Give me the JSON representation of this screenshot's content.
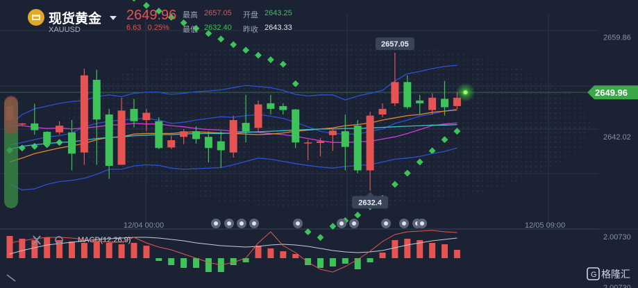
{
  "header": {
    "title": "现货黄金",
    "symbol": "XAUUSD",
    "last_price": "2649.96",
    "change": "6.63",
    "change_pct": "0.25%",
    "high_label": "最高",
    "high": "2657.05",
    "open_label": "开盘",
    "open": "2643.25",
    "low_label": "最低",
    "low": "2632.40",
    "prev_close_label": "昨收",
    "prev_close": "2643.33"
  },
  "chart_data": {
    "type": "candlestick",
    "price_axis": {
      "ticks": [
        "2659.86",
        "2642.02"
      ],
      "range": [
        2627,
        2664
      ]
    },
    "time_axis": {
      "labels": [
        "12/04 00:00",
        "12/05 09:00"
      ]
    },
    "last_price_tag": "2649.96",
    "annotations": {
      "high": "2657.05",
      "low": "2632.4"
    },
    "candles": [
      [
        2645.0,
        2647.5,
        2644.0,
        2648.5
      ],
      [
        2644.2,
        2644.4,
        2644.0,
        2644.5
      ],
      [
        2644.4,
        2643.2,
        2642.4,
        2647.9
      ],
      [
        2642.9,
        2640.8,
        2640.3,
        2643.0
      ],
      [
        2642.8,
        2644.0,
        2642.4,
        2644.8
      ],
      [
        2642.8,
        2639.0,
        2636.0,
        2645.0
      ],
      [
        2639.2,
        2653.0,
        2637.0,
        2654.2
      ],
      [
        2652.2,
        2645.1,
        2637.0,
        2654.0
      ],
      [
        2646.0,
        2636.8,
        2634.5,
        2647.0
      ],
      [
        2637.0,
        2646.7,
        2637.0,
        2649.0
      ],
      [
        2647.0,
        2644.8,
        2643.7,
        2648.8
      ],
      [
        2645.0,
        2646.3,
        2643.0,
        2647.0
      ],
      [
        2644.8,
        2640.0,
        2639.8,
        2645.5
      ],
      [
        2640.1,
        2641.4,
        2639.8,
        2642.2
      ],
      [
        2642.0,
        2643.0,
        2640.7,
        2643.4
      ],
      [
        2643.0,
        2641.6,
        2640.8,
        2643.9
      ],
      [
        2642.0,
        2640.0,
        2637.4,
        2643.0
      ],
      [
        2641.2,
        2639.6,
        2636.5,
        2643.0
      ],
      [
        2639.2,
        2645.0,
        2638.3,
        2645.8
      ],
      [
        2644.5,
        2643.0,
        2641.0,
        2649.5
      ],
      [
        2643.6,
        2647.8,
        2643.0,
        2648.5
      ],
      [
        2648.0,
        2647.0,
        2646.0,
        2649.5
      ],
      [
        2647.5,
        2646.8,
        2646.0,
        2648.0
      ],
      [
        2646.9,
        2641.0,
        2640.0,
        2647.0
      ],
      [
        2641.0,
        2641.0,
        2637.8,
        2641.5
      ],
      [
        2640.9,
        2641.2,
        2638.5,
        2641.8
      ],
      [
        2642.3,
        2643.1,
        2639.5,
        2643.7
      ],
      [
        2643.0,
        2640.2,
        2636.0,
        2646.0
      ],
      [
        2644.0,
        2636.0,
        2635.5,
        2645.0
      ],
      [
        2636.0,
        2645.8,
        2632.4,
        2646.5
      ],
      [
        2646.0,
        2647.0,
        2645.5,
        2648.0
      ],
      [
        2648.0,
        2651.8,
        2647.5,
        2657.05
      ],
      [
        2651.8,
        2647.3,
        2647.0,
        2653.0
      ],
      [
        2648.5,
        2648.0,
        2646.0,
        2649.5
      ],
      [
        2646.8,
        2649.0,
        2646.0,
        2649.8
      ],
      [
        2648.8,
        2647.3,
        2645.8,
        2652.0
      ],
      [
        2647.5,
        2649.0,
        2647.0,
        2650.0
      ]
    ],
    "indicators": [
      {
        "name": "upper band",
        "color": "#2a52d8",
        "values": [
          2644.0,
          2646.0,
          2647.0,
          2647.5,
          2648.0,
          2648.3,
          2648.5,
          2649.2,
          2649.5,
          2649.2,
          2649.8,
          2650.0,
          2650.0,
          2649.6,
          2649.8,
          2650.1,
          2650.2,
          2650.4,
          2650.8,
          2651.2,
          2651.0,
          2650.8,
          2650.3,
          2649.6,
          2649.3,
          2649.5,
          2649.5,
          2648.6,
          2649.3,
          2649.8,
          2650.3,
          2652.0,
          2653.3,
          2653.7,
          2654.2,
          2654.6,
          2654.8
        ]
      },
      {
        "name": "middle band",
        "color": "#2a52d8",
        "values": [
          2633.5,
          2632.5,
          2632.7,
          2633.5,
          2634.0,
          2634.2,
          2634.6,
          2635.3,
          2636.2,
          2636.2,
          2636.8,
          2637.0,
          2636.9,
          2636.4,
          2636.2,
          2636.3,
          2636.4,
          2636.5,
          2637.0,
          2637.6,
          2638.2,
          2638.0,
          2637.6,
          2637.2,
          2636.9,
          2636.6,
          2636.4,
          2636.7,
          2636.9,
          2637.0,
          2637.5,
          2638.0,
          2638.2,
          2638.5,
          2639.0,
          2639.4,
          2640.0
        ]
      },
      {
        "name": "lower band",
        "color": "#2a52d8",
        "values": [
          2640.5,
          2641.0,
          2641.5,
          2642.0,
          2642.2,
          2642.7,
          2643.8,
          2644.4,
          2644.8,
          2645.0,
          2645.2,
          2645.3,
          2645.0,
          2644.4,
          2644.6,
          2645.0,
          2645.3,
          2645.6,
          2645.5,
          2645.8,
          2646.0,
          2645.7,
          2645.3,
          2644.6,
          2643.8,
          2643.0,
          2642.6,
          2642.5,
          2642.5,
          2643.0,
          2643.4,
          2644.4,
          2645.0,
          2645.7,
          2646.1,
          2646.6,
          2647.0
        ]
      },
      {
        "name": "magenta line",
        "color": "#d23ae0",
        "values": [
          2644.0,
          2644.0,
          2643.7,
          2643.5,
          2643.6,
          2643.4,
          2643.6,
          2643.8,
          2644.1,
          2644.2,
          2644.4,
          2644.3,
          2644.3,
          2644.0,
          2643.8,
          2643.5,
          2643.3,
          2643.2,
          2643.0,
          2642.9,
          2642.8,
          2642.6,
          2642.4,
          2642.1,
          2641.7,
          2641.3,
          2641.0,
          2641.0,
          2641.1,
          2641.2,
          2641.6,
          2642.0,
          2642.6,
          2643.3,
          2644.0,
          2644.3,
          2644.5
        ]
      },
      {
        "name": "orange line",
        "color": "#e8882a",
        "values": [
          2637.5,
          2638.2,
          2639.0,
          2639.5,
          2640.0,
          2640.4,
          2640.8,
          2641.5,
          2641.9,
          2642.0,
          2642.5,
          2642.6,
          2642.6,
          2642.6,
          2642.8,
          2642.9,
          2642.8,
          2642.7,
          2642.6,
          2642.5,
          2642.4,
          2642.5,
          2642.7,
          2643.0,
          2643.2,
          2643.4,
          2643.6,
          2644.0,
          2644.2,
          2644.5,
          2645.0,
          2645.4,
          2645.8,
          2646.0,
          2646.4,
          2646.6,
          2646.8
        ]
      },
      {
        "name": "cyan line",
        "color": "#3fc1c9",
        "values": [
          2639.8,
          2640.3,
          2640.6,
          2640.8,
          2641.0,
          2641.1,
          2641.4,
          2641.7,
          2641.9,
          2642.0,
          2642.2,
          2642.3,
          2642.4,
          2642.4,
          2642.5,
          2642.6,
          2642.6,
          2642.6,
          2642.7,
          2642.8,
          2642.9,
          2643.0,
          2643.1,
          2643.2,
          2643.3,
          2643.4,
          2643.4,
          2643.5,
          2643.5,
          2643.6,
          2643.7,
          2643.8,
          2643.9,
          2644.0,
          2644.1,
          2644.1,
          2644.2
        ]
      }
    ],
    "sar_points": [
      {
        "i": 0,
        "y": 2639.6
      },
      {
        "i": 1,
        "y": 2640.0
      },
      {
        "i": 2,
        "y": 2640.3
      },
      {
        "i": 3,
        "y": 2640.6
      },
      {
        "i": 4,
        "y": 2641.0
      },
      {
        "i": 5,
        "y": 2641.6
      },
      {
        "i": 6,
        "y": 2642.6
      },
      {
        "i": 7,
        "y": 2671.0
      },
      {
        "i": 8,
        "y": 2669.5
      },
      {
        "i": 9,
        "y": 2668.0
      },
      {
        "i": 10,
        "y": 2666.8
      },
      {
        "i": 11,
        "y": 2665.5
      },
      {
        "i": 12,
        "y": 2664.5
      },
      {
        "i": 13,
        "y": 2663.4
      },
      {
        "i": 14,
        "y": 2662.4
      },
      {
        "i": 15,
        "y": 2661.4
      },
      {
        "i": 16,
        "y": 2660.5
      },
      {
        "i": 17,
        "y": 2659.5
      },
      {
        "i": 18,
        "y": 2658.5
      },
      {
        "i": 19,
        "y": 2657.5
      },
      {
        "i": 20,
        "y": 2656.6
      },
      {
        "i": 21,
        "y": 2655.8
      },
      {
        "i": 22,
        "y": 2655.0
      },
      {
        "i": 23,
        "y": 2651.5
      },
      {
        "i": 24,
        "y": 2625.0
      },
      {
        "i": 25,
        "y": 2624.0
      },
      {
        "i": 26,
        "y": 2626.0
      },
      {
        "i": 27,
        "y": 2627.0
      },
      {
        "i": 28,
        "y": 2628.0
      },
      {
        "i": 29,
        "y": 2629.5
      },
      {
        "i": 30,
        "y": 2631.0
      },
      {
        "i": 31,
        "y": 2633.5
      },
      {
        "i": 32,
        "y": 2635.5
      },
      {
        "i": 33,
        "y": 2637.5
      },
      {
        "i": 34,
        "y": 2639.5
      },
      {
        "i": 35,
        "y": 2641.5
      },
      {
        "i": 36,
        "y": 2643.0
      }
    ],
    "macd": {
      "label": "MACD(12,26,9)",
      "axis_ticks": [
        "2.00730",
        "2.00730"
      ],
      "histogram": [
        1.6,
        1.4,
        1.3,
        1.5,
        1.3,
        1.2,
        1.1,
        1.2,
        1.1,
        1.0,
        1.1,
        0.9,
        -0.2,
        -0.5,
        -0.7,
        -0.7,
        -1.0,
        -1.0,
        -0.5,
        -0.3,
        0.9,
        0.7,
        0.5,
        0.3,
        -0.5,
        -0.7,
        -0.6,
        -0.4,
        -0.8,
        -0.3,
        0.4,
        1.3,
        1.4,
        1.3,
        1.1,
        1.0,
        0.6
      ],
      "dif": [
        1.1,
        1.25,
        1.4,
        1.5,
        1.5,
        1.45,
        1.35,
        1.25,
        1.15,
        1.15,
        1.5,
        1.1,
        0.8,
        0.6,
        0.3,
        0.0,
        -0.3,
        -0.5,
        -0.3,
        0.0,
        1.1,
        1.9,
        0.9,
        0.4,
        -0.3,
        -0.8,
        -1.0,
        -0.6,
        -0.1,
        0.5,
        1.2,
        1.7,
        1.9,
        1.95,
        2.0,
        1.9,
        1.85
      ],
      "dea": [
        0.3,
        0.55,
        0.75,
        0.95,
        1.05,
        1.15,
        1.25,
        1.35,
        1.4,
        1.45,
        1.5,
        1.5,
        1.45,
        1.35,
        1.25,
        1.1,
        1.0,
        0.9,
        0.85,
        0.8,
        0.85,
        0.95,
        1.0,
        0.95,
        0.85,
        0.7,
        0.55,
        0.45,
        0.4,
        0.45,
        0.55,
        0.75,
        0.95,
        1.1,
        1.25,
        1.35,
        1.45
      ]
    },
    "watermark": "格隆汇"
  }
}
